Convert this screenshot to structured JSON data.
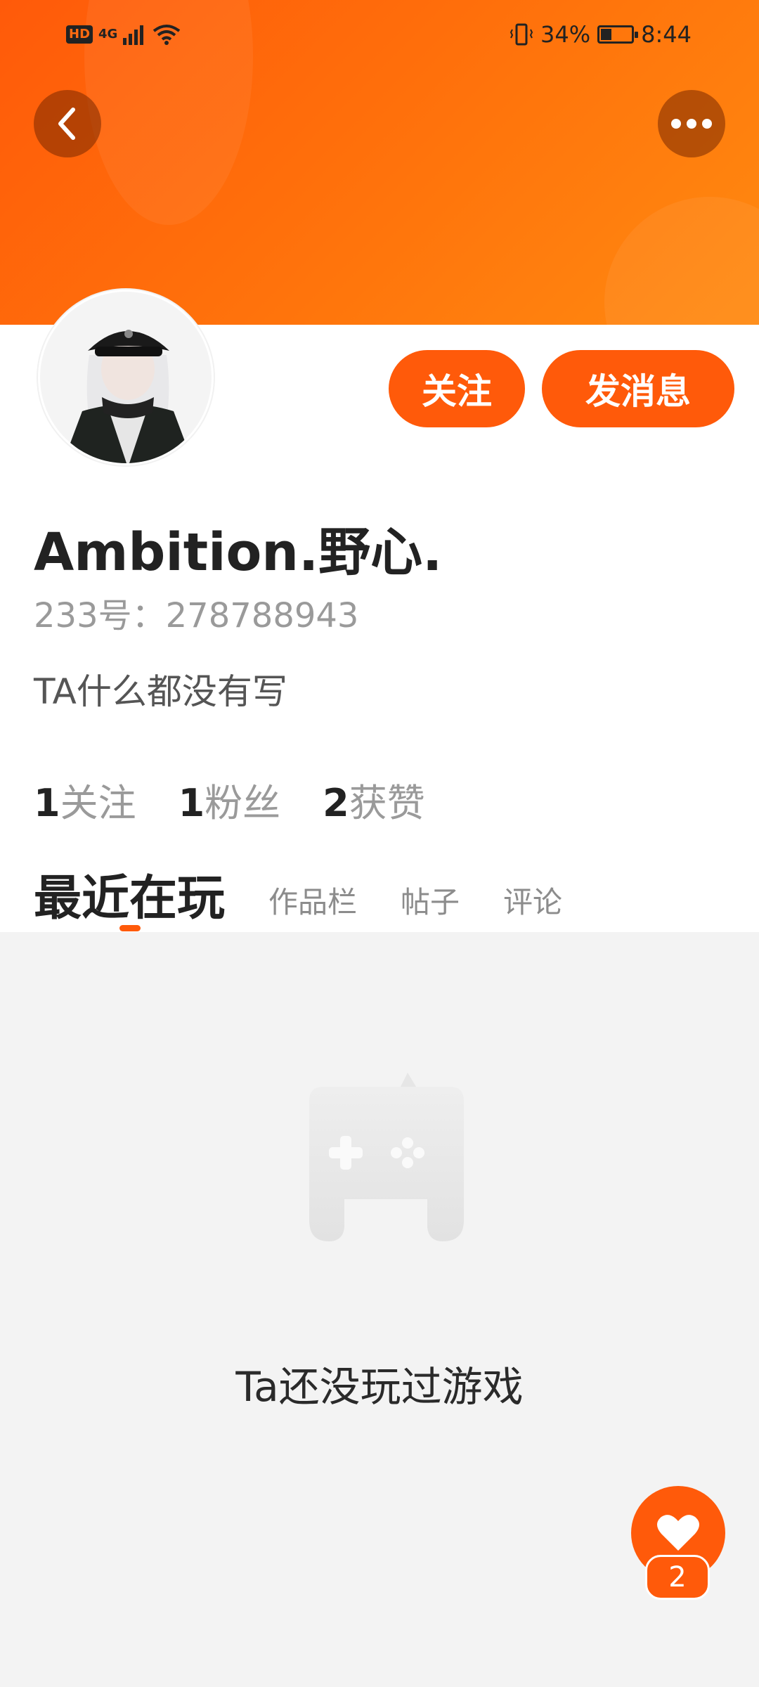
{
  "status_bar": {
    "hd": "HD",
    "network": "4G",
    "battery_percent": "34%",
    "battery_level": 0.34,
    "time": "8:44"
  },
  "header": {
    "back_icon": "chevron-left-icon",
    "more_icon": "more-horizontal-icon",
    "accent_color": "#ff5a0a"
  },
  "profile": {
    "follow_label": "关注",
    "message_label": "发消息",
    "username": "Ambition.野心.",
    "user_id": "233号：278788943",
    "bio": "TA什么都没有写",
    "stats": [
      {
        "num": "1",
        "label": "关注"
      },
      {
        "num": "1",
        "label": "粉丝"
      },
      {
        "num": "2",
        "label": "获赞"
      }
    ]
  },
  "tabs": [
    {
      "label": "最近在玩",
      "active": true
    },
    {
      "label": "作品栏",
      "active": false
    },
    {
      "label": "帖子",
      "active": false
    },
    {
      "label": "评论",
      "active": false
    }
  ],
  "empty_state": {
    "icon": "gamepad-icon",
    "message": "Ta还没玩过游戏"
  },
  "like_fab": {
    "icon": "heart-icon",
    "count": "2"
  }
}
